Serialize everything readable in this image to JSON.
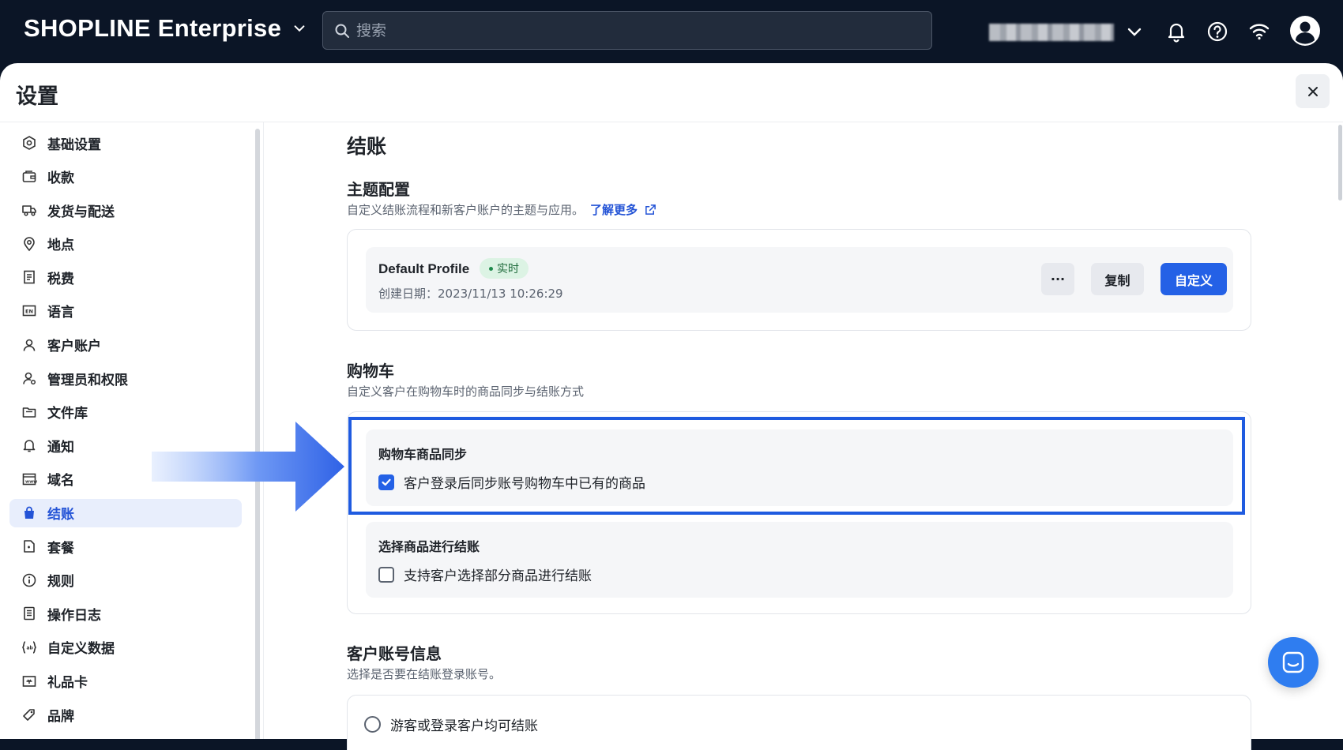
{
  "topbar": {
    "logo": "SHOPLINE Enterprise",
    "search_placeholder": "搜索"
  },
  "page": {
    "title": "设置"
  },
  "sidebar": {
    "items": [
      {
        "label": "基础设置",
        "icon": "settings-icon"
      },
      {
        "label": "收款",
        "icon": "wallet-icon"
      },
      {
        "label": "发货与配送",
        "icon": "truck-icon"
      },
      {
        "label": "地点",
        "icon": "location-pin-icon"
      },
      {
        "label": "税费",
        "icon": "receipt-icon"
      },
      {
        "label": "语言",
        "icon": "language-icon"
      },
      {
        "label": "客户账户",
        "icon": "user-icon"
      },
      {
        "label": "管理员和权限",
        "icon": "admin-icon"
      },
      {
        "label": "文件库",
        "icon": "folder-icon"
      },
      {
        "label": "通知",
        "icon": "bell-icon"
      },
      {
        "label": "域名",
        "icon": "domain-icon"
      },
      {
        "label": "结账",
        "icon": "bag-icon",
        "active": true
      },
      {
        "label": "套餐",
        "icon": "plan-icon"
      },
      {
        "label": "规则",
        "icon": "info-icon"
      },
      {
        "label": "操作日志",
        "icon": "log-icon"
      },
      {
        "label": "自定义数据",
        "icon": "code-icon"
      },
      {
        "label": "礼品卡",
        "icon": "gift-card-icon"
      },
      {
        "label": "品牌",
        "icon": "brand-icon"
      }
    ]
  },
  "checkout": {
    "title": "结账",
    "theme": {
      "title": "主题配置",
      "desc": "自定义结账流程和新客户账户的主题与应用。",
      "learn_more": "了解更多",
      "profile_name": "Default Profile",
      "status": "实时",
      "created": "创建日期：2023/11/13 10:26:29",
      "more_label": "···",
      "copy_label": "复制",
      "customize_label": "自定义"
    },
    "cart": {
      "title": "购物车",
      "desc": "自定义客户在购物车时的商品同步与结账方式",
      "sync_title": "购物车商品同步",
      "sync_option": "客户登录后同步账号购物车中已有的商品",
      "sync_checked": true,
      "select_title": "选择商品进行结账",
      "select_option": "支持客户选择部分商品进行结账",
      "select_checked": false
    },
    "account": {
      "title": "客户账号信息",
      "desc": "选择是否要在结账登录账号。",
      "option1": "游客或登录客户均可结账"
    }
  },
  "colors": {
    "topbar": "#0b1526",
    "accent": "#2461e6",
    "highlight": "#1f5be0"
  }
}
